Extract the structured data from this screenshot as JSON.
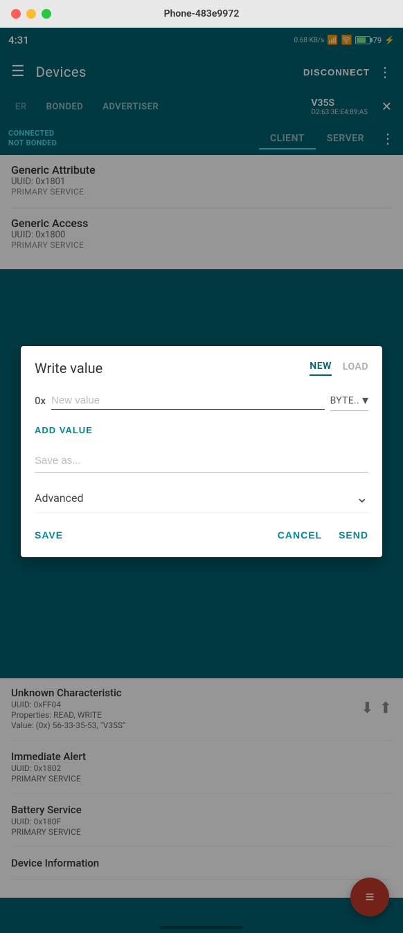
{
  "window": {
    "title": "Phone-483e9972"
  },
  "status_bar": {
    "time": "4:31",
    "data_speed": "0.68 KB/s",
    "battery_level": "79"
  },
  "app_bar": {
    "title": "Devices",
    "disconnect_label": "DISCONNECT",
    "hamburger_icon": "☰",
    "more_icon": "⋮"
  },
  "tabs_row1": {
    "tab_er": "ER",
    "tab_bonded": "BONDED",
    "tab_advertiser": "ADVERTISER",
    "device_name": "V35S",
    "device_mac": "D2:63:3E:E4:89:A5",
    "close_icon": "✕"
  },
  "sub_header": {
    "connected_line1": "CONNECTED",
    "connected_line2": "NOT BONDED",
    "tab_client": "CLIENT",
    "tab_server": "SERVER",
    "more_icon": "⋮"
  },
  "services": [
    {
      "name": "Generic Attribute",
      "uuid": "UUID: 0x1801",
      "type": "PRIMARY SERVICE"
    },
    {
      "name": "Generic Access",
      "uuid": "UUID: 0x1800",
      "type": "PRIMARY SERVICE"
    }
  ],
  "dialog": {
    "title": "Write value",
    "tab_new": "NEW",
    "tab_load": "LOAD",
    "hex_prefix": "0x",
    "value_placeholder": "New value",
    "type_label": "BYTE..",
    "add_value_label": "ADD VALUE",
    "save_as_placeholder": "Save as...",
    "advanced_label": "Advanced",
    "chevron_down": "⌄",
    "save_label": "SAVE",
    "cancel_label": "CANCEL",
    "send_label": "SEND"
  },
  "characteristics": [
    {
      "name": "Unknown Characteristic",
      "uuid": "UUID: 0xFF04",
      "properties": "Properties: READ, WRITE",
      "value": "Value: (0x) 56-33-35-53, \"V35S\""
    },
    {
      "name": "Immediate Alert",
      "uuid": "UUID: 0x1802",
      "type": "PRIMARY SERVICE"
    },
    {
      "name": "Battery Service",
      "uuid": "UUID: 0x180F",
      "type": "PRIMARY SERVICE"
    },
    {
      "name": "Device Information",
      "uuid": ""
    }
  ],
  "fab": {
    "icon": "≡"
  }
}
